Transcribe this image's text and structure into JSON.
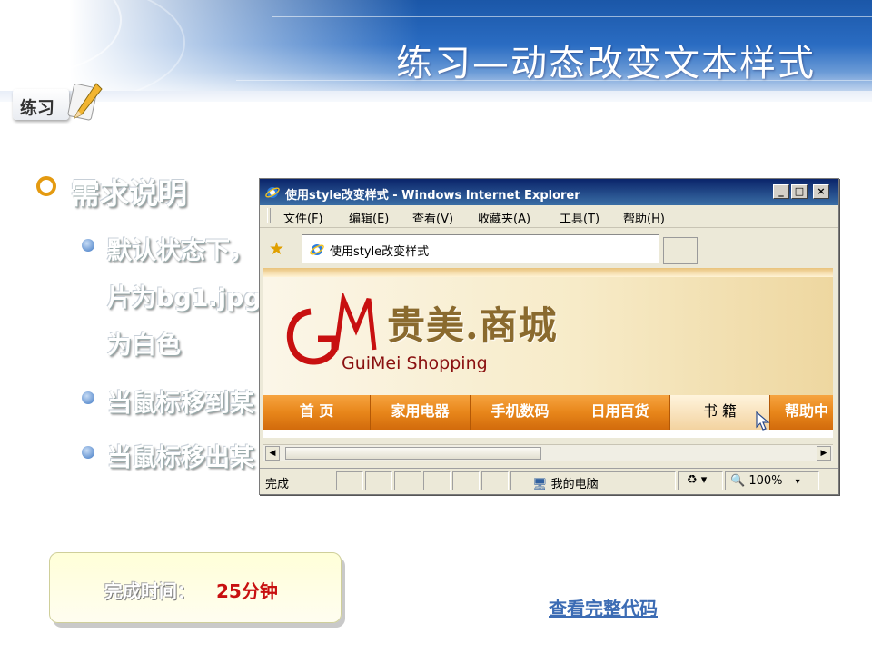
{
  "slide": {
    "title": "练习—动态改变文本样式",
    "badge": "练习",
    "bullets": {
      "heading": "需求说明",
      "item1_line1": "默认状态下，",
      "item1_line2": "片为bg1.jpg",
      "item1_line3": "为白色",
      "item2": "当鼠标移到某",
      "item3": "当鼠标移出某"
    },
    "time_label": "完成时间：",
    "time_value": "25分钟",
    "view_code_link": "查看完整代码"
  },
  "browser": {
    "window_title": "使用style改变样式 - Windows Internet Explorer",
    "menu": [
      "文件(F)",
      "编辑(E)",
      "查看(V)",
      "收藏夹(A)",
      "工具(T)",
      "帮助(H)"
    ],
    "tab_title": "使用style改变样式",
    "page": {
      "brand_cn": "贵美.商城",
      "brand_en": "GuiMei Shopping",
      "nav": [
        "首  页",
        "家用电器",
        "手机数码",
        "日用百货",
        "书  籍",
        "帮助中"
      ],
      "active_nav_index": 4
    },
    "status": {
      "left": "完成",
      "zone": "我的电脑",
      "zoom": "100%"
    }
  },
  "colors": {
    "header_blue": "#1b57a8",
    "bullet_orange": "#e49a10",
    "nav_orange": "#e8861a",
    "time_red": "#c81010",
    "link_blue": "#3c6cb4"
  }
}
